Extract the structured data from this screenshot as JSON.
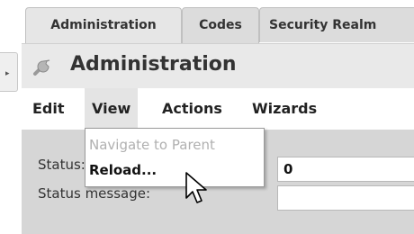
{
  "tabs": [
    {
      "label": "Administration"
    },
    {
      "label": "Codes"
    },
    {
      "label": "Security Realm"
    }
  ],
  "header": {
    "title": "Administration",
    "icon": "wrench-icon"
  },
  "menubar": {
    "items": [
      {
        "label": "Edit"
      },
      {
        "label": "View"
      },
      {
        "label": "Actions"
      },
      {
        "label": "Wizards"
      }
    ]
  },
  "view_menu": {
    "items": [
      {
        "label": "Navigate to Parent",
        "enabled": false
      },
      {
        "label": "Reload...",
        "enabled": true
      }
    ]
  },
  "form": {
    "status_label": "Status:",
    "status_value": "0",
    "message_label": "Status message:",
    "message_value": ""
  },
  "colors": {
    "tab_bg": "#dcdcdc",
    "header_bg": "#e9e9e9",
    "content_bg": "#d6d6d6",
    "disabled_text": "#b0b0b0"
  }
}
